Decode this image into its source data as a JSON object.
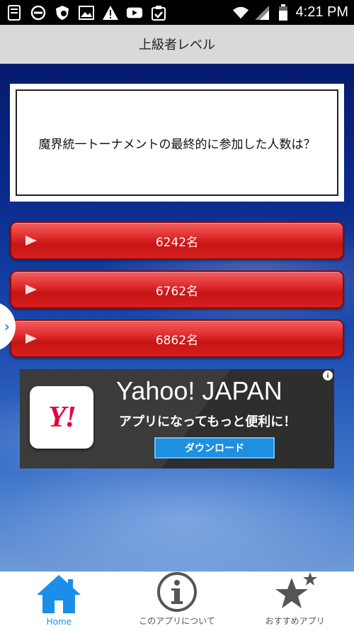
{
  "status_bar": {
    "time": "4:21 PM",
    "left_icons": [
      "document-icon",
      "do-not-disturb-icon",
      "shield-icon",
      "image-icon",
      "warning-icon",
      "youtube-icon",
      "clipboard-check-icon"
    ],
    "right_icons": [
      "wifi-icon",
      "signal-icon",
      "battery-icon"
    ]
  },
  "title_bar": {
    "title": "上級者レベル"
  },
  "question": {
    "text": "魔界統一トーナメントの最終的に参加した人数は？"
  },
  "answers": [
    {
      "label": "6242名"
    },
    {
      "label": "6762名"
    },
    {
      "label": "6862名"
    }
  ],
  "ad": {
    "logo_text": "Y!",
    "title": "Yahoo! JAPAN",
    "subtitle": "アプリになってもっと便利に！",
    "download_label": "ダウンロード",
    "info_label": "i"
  },
  "tab_bar": {
    "tabs": [
      {
        "label": "Home",
        "icon": "home-icon",
        "active": true
      },
      {
        "label": "このアプリについて",
        "icon": "info-icon",
        "active": false
      },
      {
        "label": "おすすめアプリ",
        "icon": "stars-icon",
        "active": false
      }
    ]
  },
  "colors": {
    "answer_button": "#d62020",
    "tab_active": "#1a8ee8",
    "ad_download": "#1f8fe0",
    "yahoo_red": "#e6003e"
  }
}
